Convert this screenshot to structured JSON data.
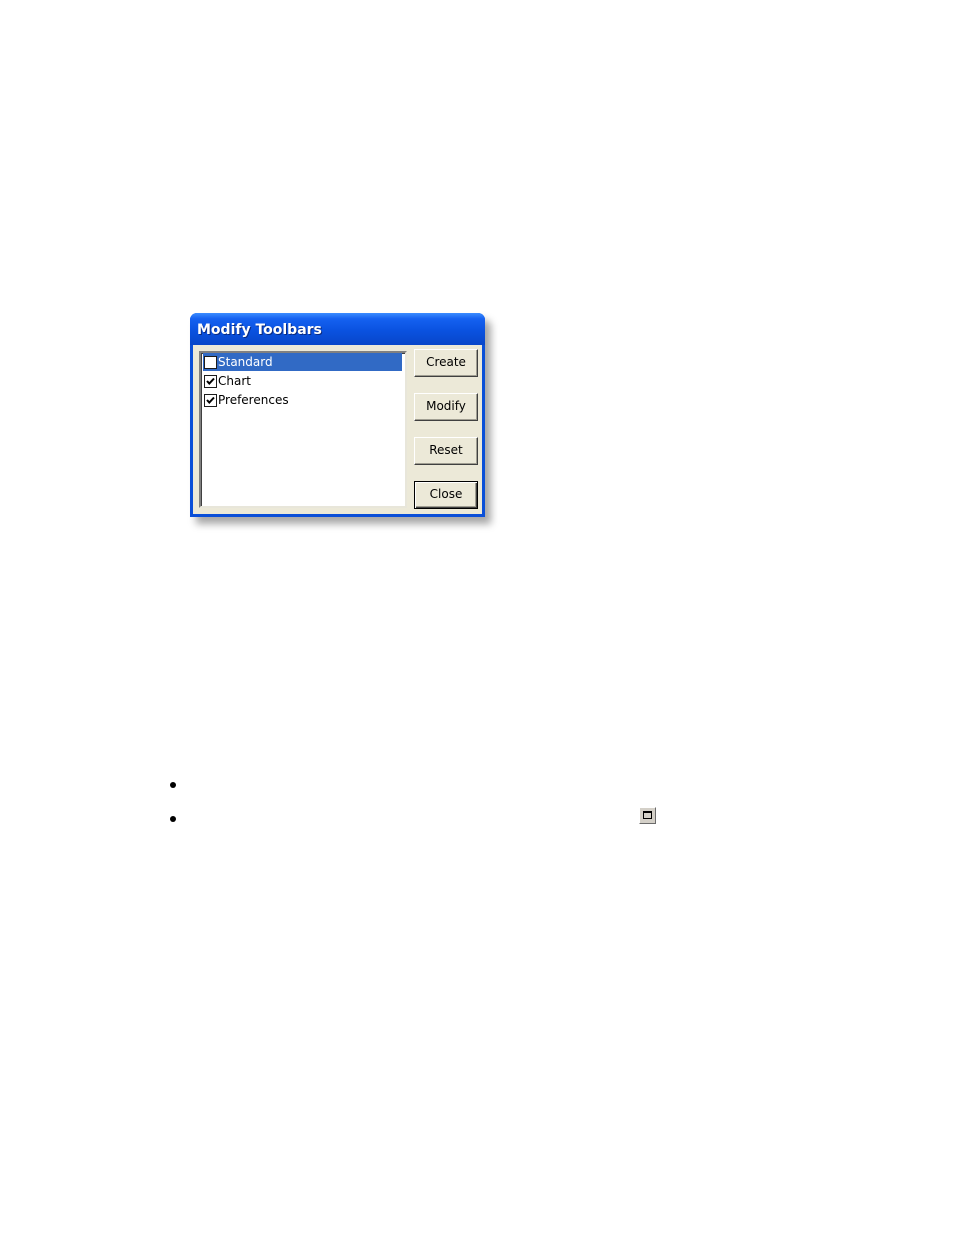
{
  "dialog": {
    "title": "Modify Toolbars",
    "titlebar_color": "#0a52e0",
    "toolbars": [
      {
        "label": "Standard",
        "checked": false,
        "selected": true
      },
      {
        "label": "Chart",
        "checked": true,
        "selected": false
      },
      {
        "label": "Preferences",
        "checked": true,
        "selected": false
      }
    ],
    "buttons": {
      "create": "Create",
      "modify": "Modify",
      "reset": "Reset",
      "close": "Close"
    },
    "selection_color": "#316ac5"
  },
  "bullets": {
    "count": 2
  },
  "inline_icon": {
    "name": "restore-window-icon"
  }
}
